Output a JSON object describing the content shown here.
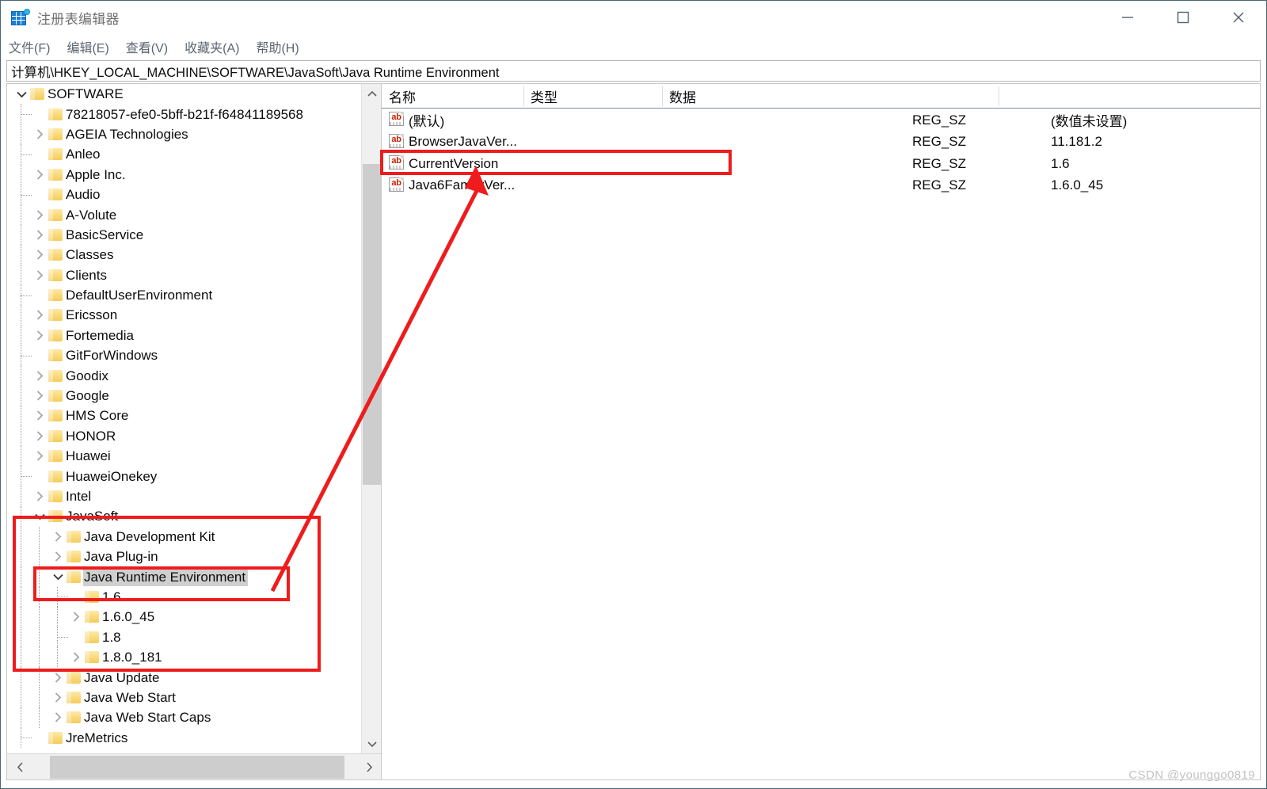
{
  "window": {
    "title": "注册表编辑器",
    "icon": "registry-editor-icon",
    "controls": {
      "minimize": "最小化",
      "maximize": "最大化",
      "close": "关闭"
    }
  },
  "menu": {
    "items": [
      {
        "label": "文件(F)"
      },
      {
        "label": "编辑(E)"
      },
      {
        "label": "查看(V)"
      },
      {
        "label": "收藏夹(A)"
      },
      {
        "label": "帮助(H)"
      }
    ]
  },
  "address": {
    "path": "计算机\\HKEY_LOCAL_MACHINE\\SOFTWARE\\JavaSoft\\Java Runtime Environment"
  },
  "tree": {
    "nodes": [
      {
        "label": "SOFTWARE",
        "depth": 0,
        "chevron": "down",
        "selected": false
      },
      {
        "label": "78218057-efe0-5bff-b21f-f64841189568",
        "depth": 1,
        "chevron": "none",
        "selected": false
      },
      {
        "label": "AGEIA Technologies",
        "depth": 1,
        "chevron": "right",
        "selected": false
      },
      {
        "label": "Anleo",
        "depth": 1,
        "chevron": "none",
        "selected": false
      },
      {
        "label": "Apple Inc.",
        "depth": 1,
        "chevron": "right",
        "selected": false
      },
      {
        "label": "Audio",
        "depth": 1,
        "chevron": "none",
        "selected": false
      },
      {
        "label": "A-Volute",
        "depth": 1,
        "chevron": "right",
        "selected": false
      },
      {
        "label": "BasicService",
        "depth": 1,
        "chevron": "right",
        "selected": false
      },
      {
        "label": "Classes",
        "depth": 1,
        "chevron": "right",
        "selected": false
      },
      {
        "label": "Clients",
        "depth": 1,
        "chevron": "right",
        "selected": false
      },
      {
        "label": "DefaultUserEnvironment",
        "depth": 1,
        "chevron": "none",
        "selected": false
      },
      {
        "label": "Ericsson",
        "depth": 1,
        "chevron": "right",
        "selected": false
      },
      {
        "label": "Fortemedia",
        "depth": 1,
        "chevron": "right",
        "selected": false
      },
      {
        "label": "GitForWindows",
        "depth": 1,
        "chevron": "none",
        "selected": false
      },
      {
        "label": "Goodix",
        "depth": 1,
        "chevron": "right",
        "selected": false
      },
      {
        "label": "Google",
        "depth": 1,
        "chevron": "right",
        "selected": false
      },
      {
        "label": "HMS Core",
        "depth": 1,
        "chevron": "right",
        "selected": false
      },
      {
        "label": "HONOR",
        "depth": 1,
        "chevron": "right",
        "selected": false
      },
      {
        "label": "Huawei",
        "depth": 1,
        "chevron": "right",
        "selected": false
      },
      {
        "label": "HuaweiOnekey",
        "depth": 1,
        "chevron": "none",
        "selected": false
      },
      {
        "label": "Intel",
        "depth": 1,
        "chevron": "right",
        "selected": false
      },
      {
        "label": "JavaSoft",
        "depth": 1,
        "chevron": "down",
        "selected": false
      },
      {
        "label": "Java Development Kit",
        "depth": 2,
        "chevron": "right",
        "selected": false
      },
      {
        "label": "Java Plug-in",
        "depth": 2,
        "chevron": "right",
        "selected": false
      },
      {
        "label": "Java Runtime Environment",
        "depth": 2,
        "chevron": "down",
        "selected": true
      },
      {
        "label": "1.6",
        "depth": 3,
        "chevron": "none",
        "selected": false
      },
      {
        "label": "1.6.0_45",
        "depth": 3,
        "chevron": "right",
        "selected": false
      },
      {
        "label": "1.8",
        "depth": 3,
        "chevron": "none",
        "selected": false
      },
      {
        "label": "1.8.0_181",
        "depth": 3,
        "chevron": "right",
        "selected": false
      },
      {
        "label": "Java Update",
        "depth": 2,
        "chevron": "right",
        "selected": false
      },
      {
        "label": "Java Web Start",
        "depth": 2,
        "chevron": "right",
        "selected": false
      },
      {
        "label": "Java Web Start Caps",
        "depth": 2,
        "chevron": "right",
        "selected": false
      },
      {
        "label": "JreMetrics",
        "depth": 1,
        "chevron": "none",
        "selected": false
      }
    ]
  },
  "values": {
    "columns": [
      "名称",
      "类型",
      "数据"
    ],
    "rows": [
      {
        "name": "(默认)",
        "type": "REG_SZ",
        "data": "(数值未设置)",
        "icon": "string-value-icon",
        "highlighted": false
      },
      {
        "name": "BrowserJavaVer...",
        "type": "REG_SZ",
        "data": "11.181.2",
        "icon": "string-value-icon",
        "highlighted": false
      },
      {
        "name": "CurrentVersion",
        "type": "REG_SZ",
        "data": "1.6",
        "icon": "string-value-icon",
        "highlighted": true
      },
      {
        "name": "Java6FamilyVer...",
        "type": "REG_SZ",
        "data": "1.6.0_45",
        "icon": "string-value-icon",
        "highlighted": false
      }
    ]
  },
  "annotations": {
    "color": "#ee1c1c",
    "arrow_label": "arrow-from-java-runtime-environment-to-currentversion",
    "boxes": [
      "box-currentversion-row",
      "box-javasoft-subtree",
      "box-java-runtime-environment-node"
    ]
  },
  "watermark": {
    "text": "CSDN @younggo0819"
  }
}
